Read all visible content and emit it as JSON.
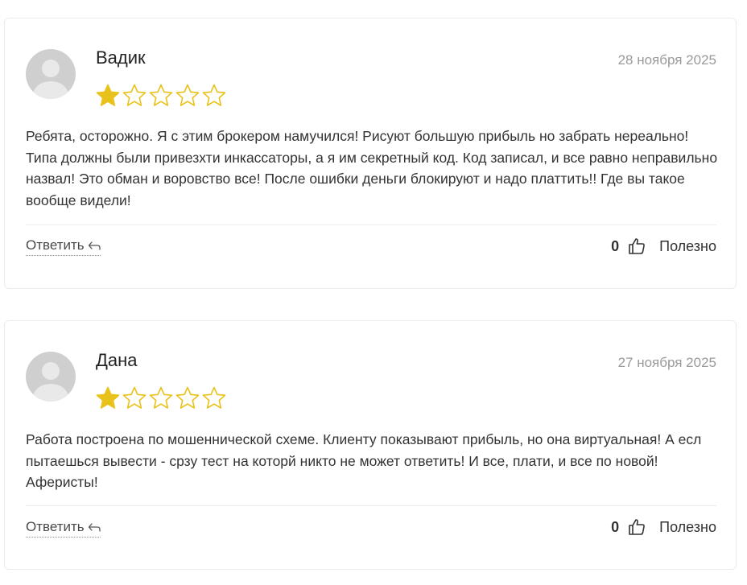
{
  "reviews": [
    {
      "author": "Вадик",
      "date": "28 ноября 2025",
      "rating": 1,
      "rating_max": 5,
      "text": "Ребята, осторожно. Я с этим брокером намучился! Рисуют большую прибыль но забрать нереально! Типа должны были привезхти инкассаторы, а я им секретный код. Код записал, и все равно неправильно назвал! Это обман и воровство все! После ошибки деньги блокируют и надо платтить!! Где вы такое вообще видели!",
      "reply_label": "Ответить",
      "helpful_count": "0",
      "helpful_label": "Полезно"
    },
    {
      "author": "Дана",
      "date": "27 ноября 2025",
      "rating": 1,
      "rating_max": 5,
      "text": "Работа построена по мошеннической схеме. Клиенту показывают прибыль, но она виртуальная! А есл пытаешься вывести - срзу тест на которй никто не может ответить! И все, плати, и все по новой! Аферисты!",
      "reply_label": "Ответить",
      "helpful_count": "0",
      "helpful_label": "Полезно"
    }
  ],
  "colors": {
    "star_filled": "#e8c21a",
    "star_empty_stroke": "#e8c21a",
    "date": "#9a9a9a",
    "border": "#ececec"
  },
  "icons": {
    "reply": "reply-arrow-icon",
    "helpful": "thumbs-up-icon",
    "avatar": "default-user-avatar"
  }
}
